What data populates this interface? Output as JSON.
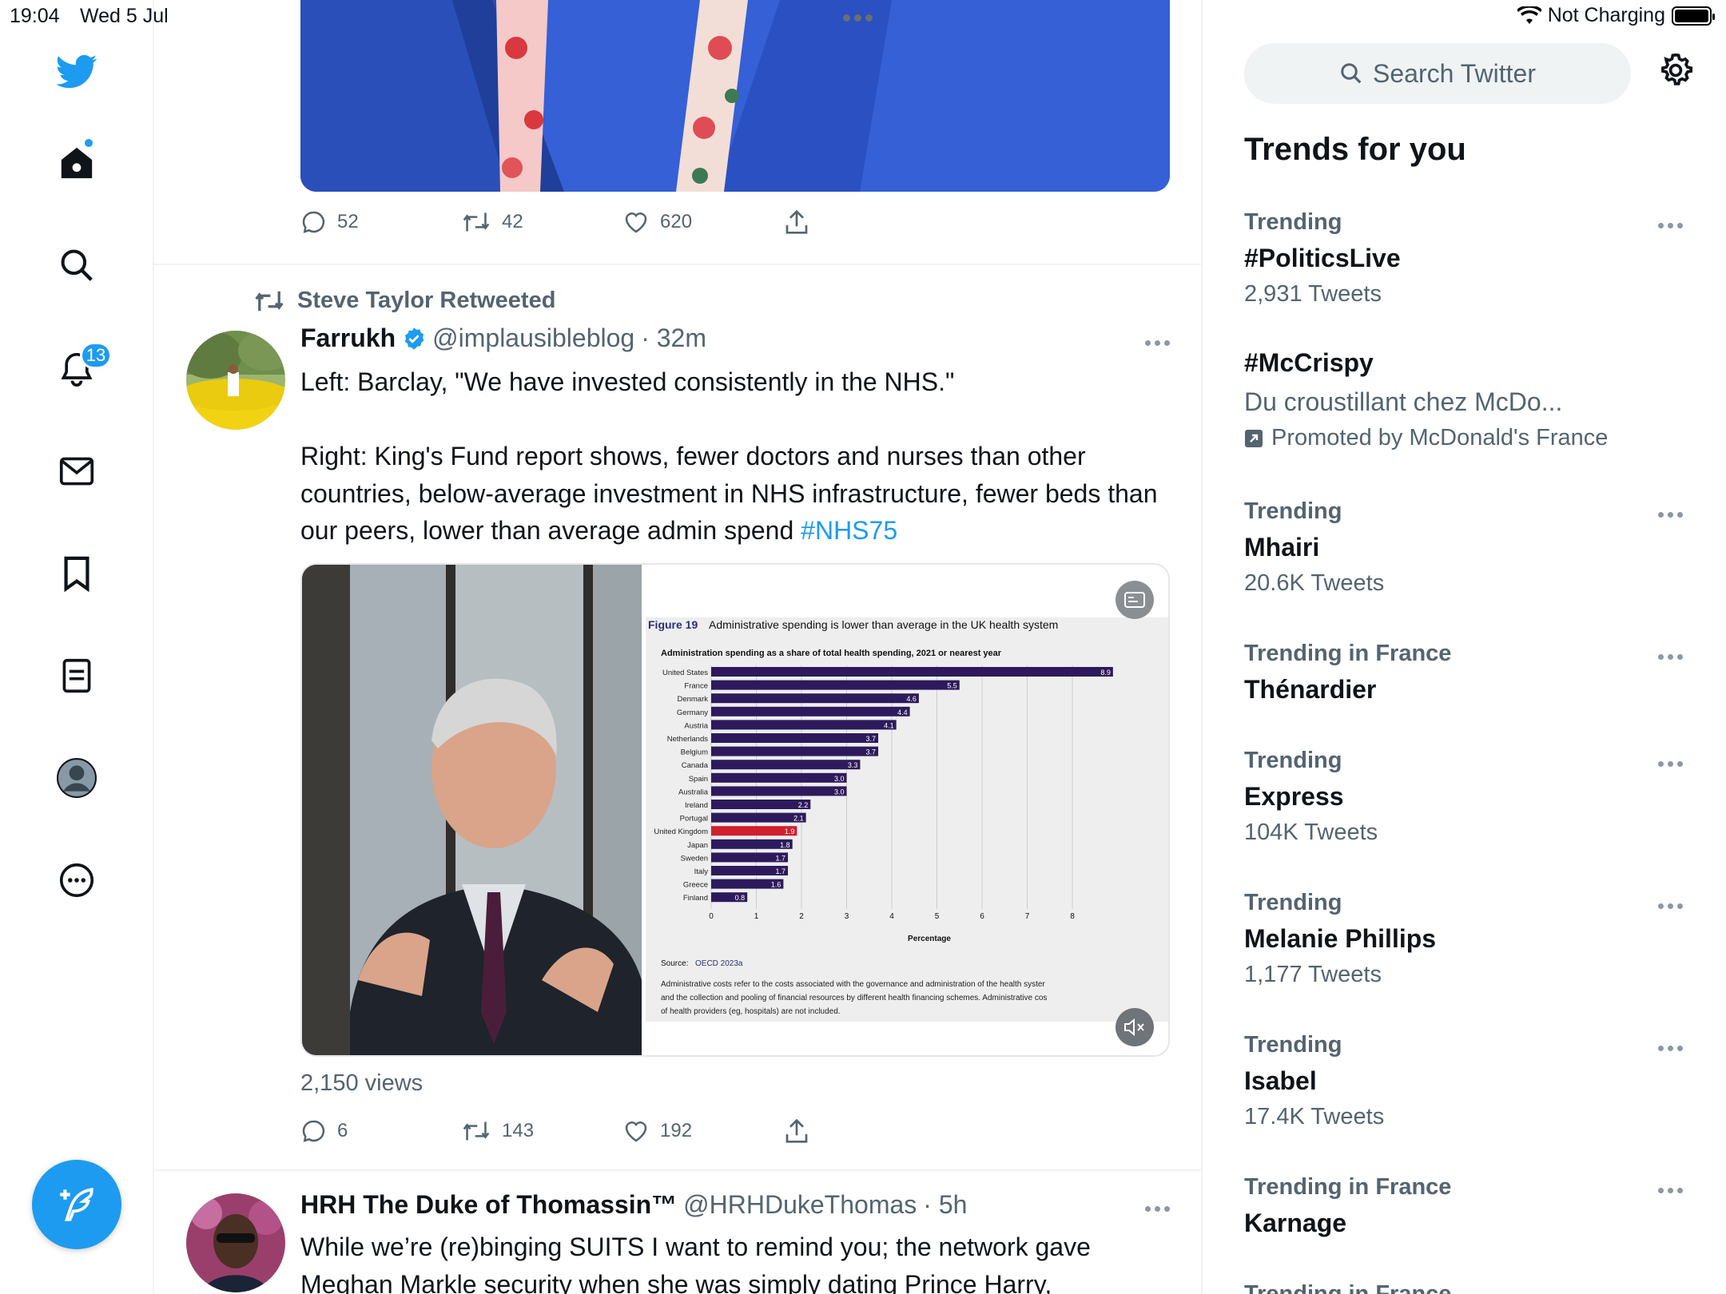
{
  "status": {
    "time": "19:04",
    "date": "Wed 5 Jul",
    "charging": "Not Charging"
  },
  "nav": {
    "notifications_badge": "13"
  },
  "tweet_prev": {
    "replies": "52",
    "retweets": "42",
    "likes": "620"
  },
  "tweet_main": {
    "retweeted_by": "Steve Taylor Retweeted",
    "name": "Farrukh",
    "handle": "@implausibleblog",
    "time": "· 32m",
    "text_line1": "Left: Barclay, \"We have invested consistently in the NHS.\"",
    "text_body": "Right: King's Fund report shows, fewer doctors and nurses than other countries, below-average investment in NHS infrastructure, fewer beds than our peers, lower than average admin spend ",
    "hashtag": "#NHS75",
    "views": "2,150 views",
    "replies": "6",
    "retweets": "143",
    "likes": "192",
    "media_chart": {
      "figure_label": "Figure 19",
      "figure_title": "Administrative spending is lower than average in the UK health system",
      "subtitle": "Administration spending as a share of total health spending, 2021 or nearest year",
      "source_label": "Source:",
      "source": "OECD 2023a",
      "note_line1": "Administrative costs refer to the costs associated with the governance and administration of the health syster",
      "note_line2": "and the collection and pooling of financial resources by different health financing schemes. Administrative cos",
      "note_line3": "of health providers (eg, hospitals) are not included."
    }
  },
  "chart_data": {
    "type": "bar",
    "orientation": "horizontal",
    "title": "Administrative spending is lower than average in the UK health system",
    "xlabel": "Percentage",
    "xlim": [
      0,
      8
    ],
    "xticks": [
      0,
      1,
      2,
      3,
      4,
      5,
      6,
      7,
      8
    ],
    "categories": [
      "United States",
      "France",
      "Denmark",
      "Germany",
      "Austria",
      "Netherlands",
      "Belgium",
      "Canada",
      "Spain",
      "Australia",
      "Ireland",
      "Portugal",
      "United Kingdom",
      "Japan",
      "Sweden",
      "Italy",
      "Greece",
      "Finland"
    ],
    "values": [
      8.9,
      5.5,
      4.6,
      4.4,
      4.1,
      3.7,
      3.7,
      3.3,
      3.0,
      3.0,
      2.2,
      2.1,
      1.9,
      1.8,
      1.7,
      1.7,
      1.6,
      0.8
    ],
    "value_labels": [
      "8.9",
      "5.5",
      "4.6",
      "4.4",
      "4.1",
      "3.7",
      "3.7",
      "3.3",
      "3.0",
      "3.0",
      "2.2",
      "2.1",
      "1.9",
      "1.8",
      "1.7",
      "1.7",
      "1.6",
      "0.8"
    ],
    "highlight": "United Kingdom",
    "colors": {
      "bar": "#2d1a5c",
      "highlight": "#d0202e",
      "plot_bg": "#eeeeee"
    }
  },
  "tweet_next": {
    "name": "HRH The Duke of Thomassin™",
    "handle": "@HRHDukeThomas",
    "time": "· 5h",
    "text_line1": "While we’re (re)binging SUITS I want to remind you; the network gave",
    "text_line2": "Meghan Markle security when she was simply dating Prince Harry,"
  },
  "right": {
    "search_placeholder": "Search Twitter",
    "trends_title": "Trends for you",
    "trends": [
      {
        "context": "Trending",
        "name": "#PoliticsLive",
        "count": "2,931 Tweets"
      },
      {
        "name": "#McCrispy",
        "description": "Du croustillant chez McDo...",
        "promoted": "Promoted by McDonald's France"
      },
      {
        "context": "Trending",
        "name": "Mhairi",
        "count": "20.6K Tweets"
      },
      {
        "context": "Trending in France",
        "name": "Thénardier"
      },
      {
        "context": "Trending",
        "name": "Express",
        "count": "104K Tweets"
      },
      {
        "context": "Trending",
        "name": "Melanie Phillips",
        "count": "1,177 Tweets"
      },
      {
        "context": "Trending",
        "name": "Isabel",
        "count": "17.4K Tweets"
      },
      {
        "context": "Trending in France",
        "name": "Karnage"
      },
      {
        "context": "Trending in France"
      }
    ]
  }
}
